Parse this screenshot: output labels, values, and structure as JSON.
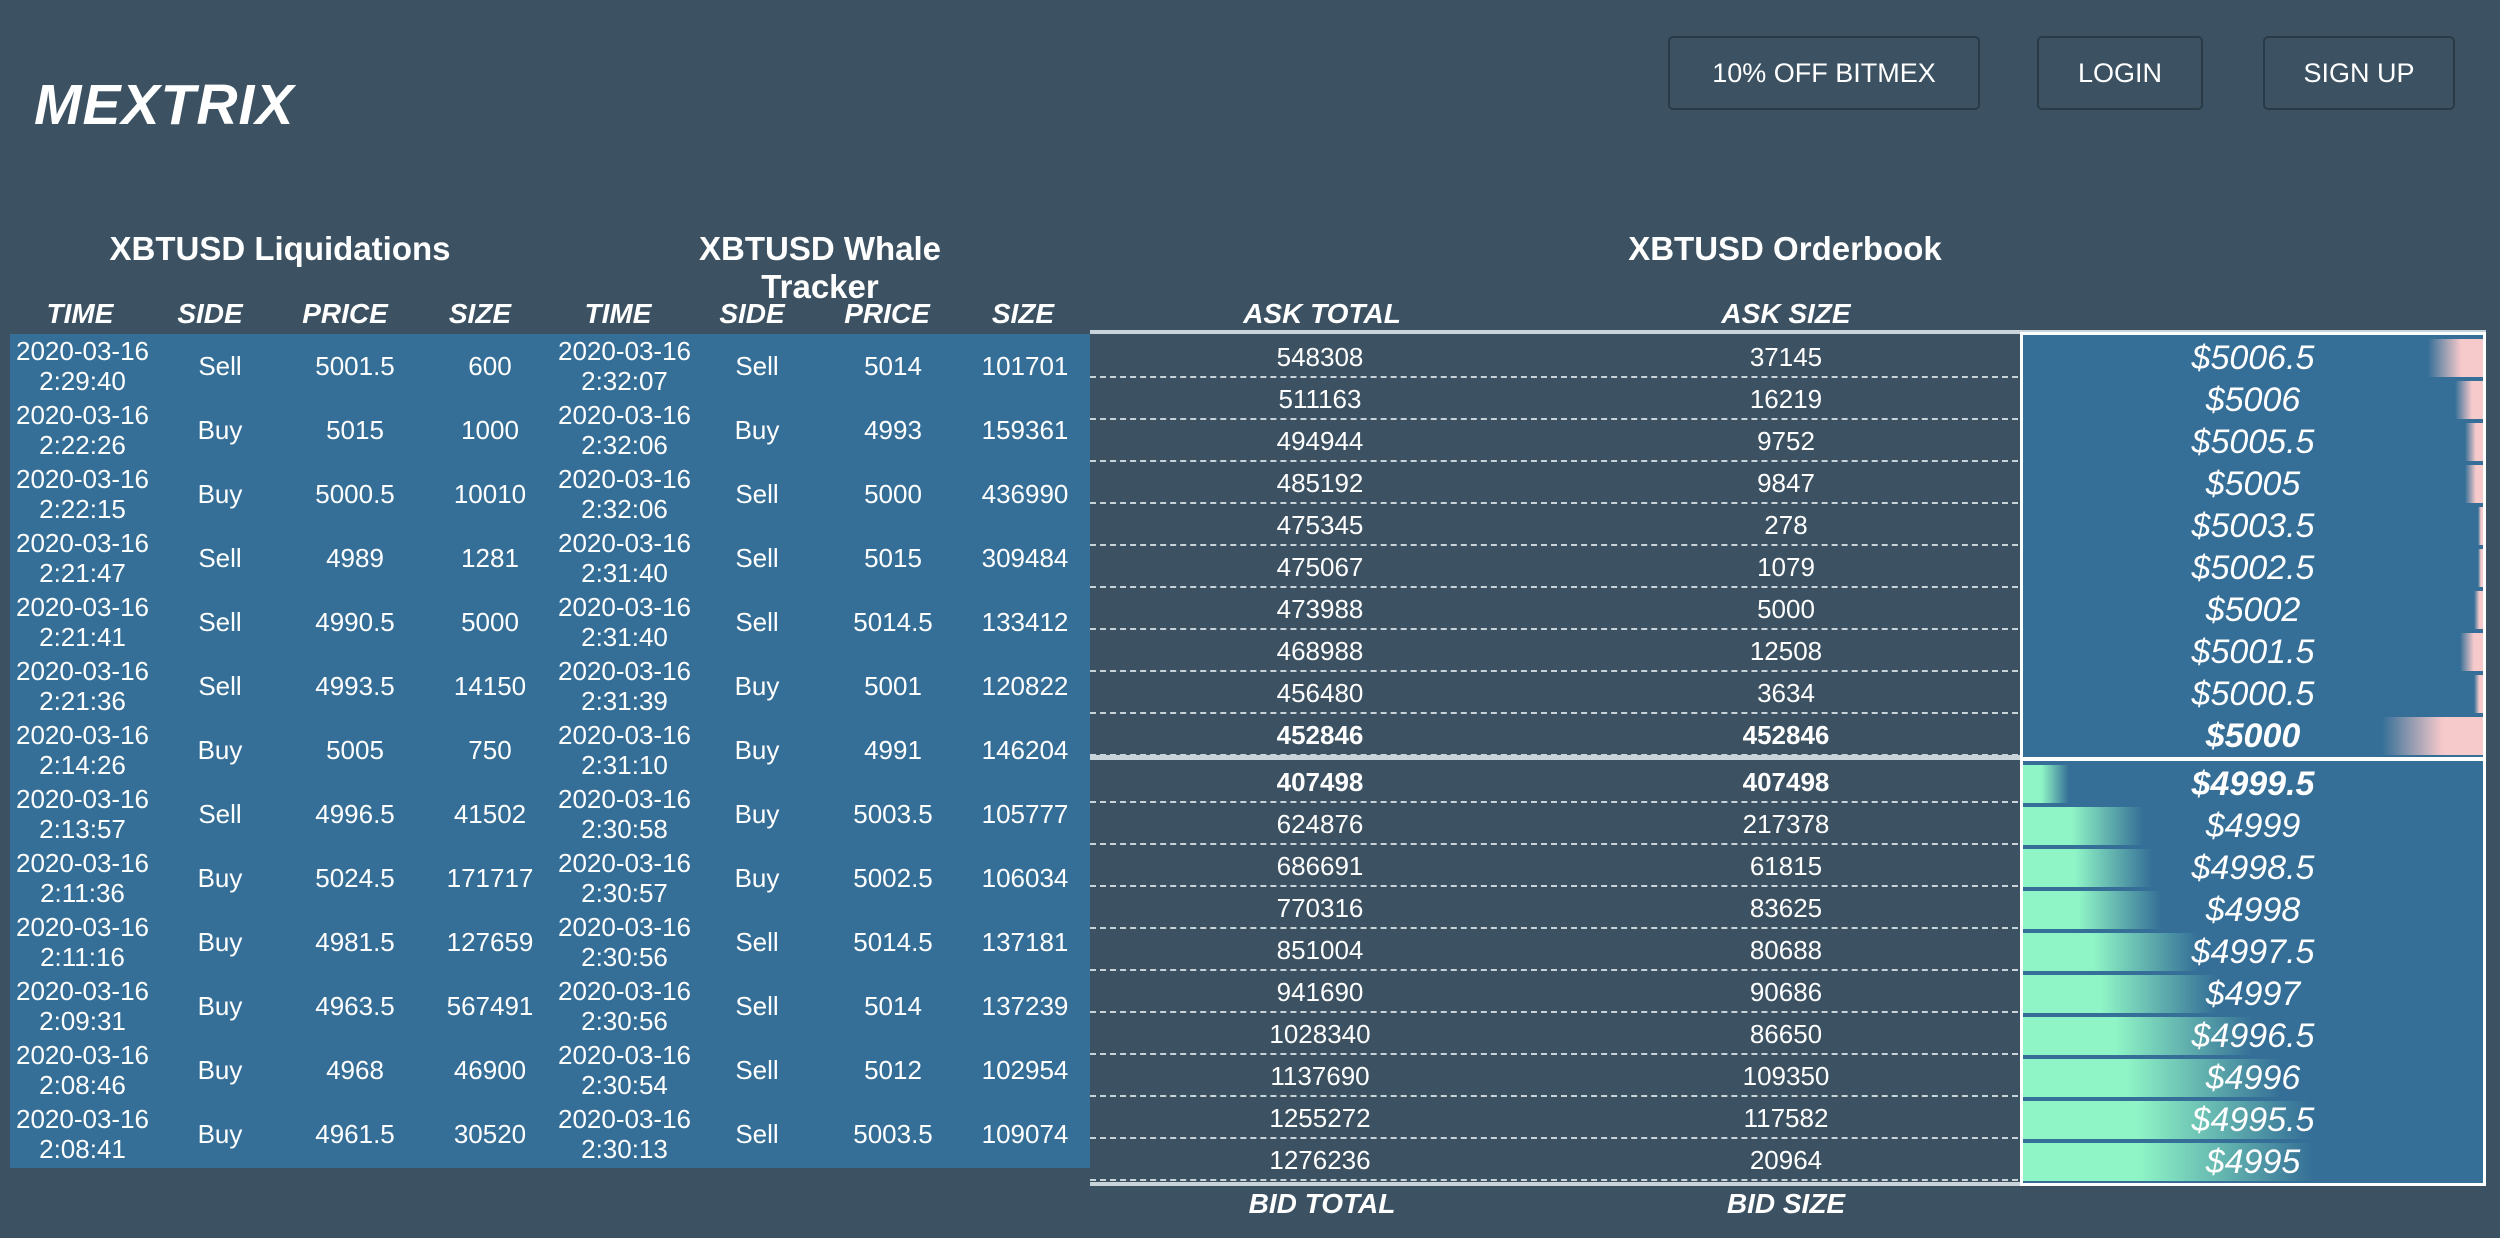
{
  "brand": "MEXTRIX",
  "nav": {
    "promo": "10% OFF BITMEX",
    "login": "LOGIN",
    "signup": "SIGN UP"
  },
  "liquidations": {
    "title": "XBTUSD Liquidations",
    "headers": [
      "TIME",
      "SIDE",
      "PRICE",
      "SIZE"
    ],
    "rows": [
      {
        "date": "2020-03-16",
        "time": "2:29:40",
        "side": "Sell",
        "price": "5001.5",
        "size": "600"
      },
      {
        "date": "2020-03-16",
        "time": "2:22:26",
        "side": "Buy",
        "price": "5015",
        "size": "1000"
      },
      {
        "date": "2020-03-16",
        "time": "2:22:15",
        "side": "Buy",
        "price": "5000.5",
        "size": "10010"
      },
      {
        "date": "2020-03-16",
        "time": "2:21:47",
        "side": "Sell",
        "price": "4989",
        "size": "1281"
      },
      {
        "date": "2020-03-16",
        "time": "2:21:41",
        "side": "Sell",
        "price": "4990.5",
        "size": "5000"
      },
      {
        "date": "2020-03-16",
        "time": "2:21:36",
        "side": "Sell",
        "price": "4993.5",
        "size": "14150"
      },
      {
        "date": "2020-03-16",
        "time": "2:14:26",
        "side": "Buy",
        "price": "5005",
        "size": "750"
      },
      {
        "date": "2020-03-16",
        "time": "2:13:57",
        "side": "Sell",
        "price": "4996.5",
        "size": "41502"
      },
      {
        "date": "2020-03-16",
        "time": "2:11:36",
        "side": "Buy",
        "price": "5024.5",
        "size": "171717"
      },
      {
        "date": "2020-03-16",
        "time": "2:11:16",
        "side": "Buy",
        "price": "4981.5",
        "size": "127659"
      },
      {
        "date": "2020-03-16",
        "time": "2:09:31",
        "side": "Buy",
        "price": "4963.5",
        "size": "567491"
      },
      {
        "date": "2020-03-16",
        "time": "2:08:46",
        "side": "Buy",
        "price": "4968",
        "size": "46900"
      },
      {
        "date": "2020-03-16",
        "time": "2:08:41",
        "side": "Buy",
        "price": "4961.5",
        "size": "30520"
      }
    ]
  },
  "whales": {
    "title": "XBTUSD Whale Tracker",
    "headers": [
      "TIME",
      "SIDE",
      "PRICE",
      "SIZE"
    ],
    "rows": [
      {
        "date": "2020-03-16",
        "time": "2:32:07",
        "side": "Sell",
        "price": "5014",
        "size": "101701"
      },
      {
        "date": "2020-03-16",
        "time": "2:32:06",
        "side": "Buy",
        "price": "4993",
        "size": "159361"
      },
      {
        "date": "2020-03-16",
        "time": "2:32:06",
        "side": "Sell",
        "price": "5000",
        "size": "436990"
      },
      {
        "date": "2020-03-16",
        "time": "2:31:40",
        "side": "Sell",
        "price": "5015",
        "size": "309484"
      },
      {
        "date": "2020-03-16",
        "time": "2:31:40",
        "side": "Sell",
        "price": "5014.5",
        "size": "133412"
      },
      {
        "date": "2020-03-16",
        "time": "2:31:39",
        "side": "Buy",
        "price": "5001",
        "size": "120822"
      },
      {
        "date": "2020-03-16",
        "time": "2:31:10",
        "side": "Buy",
        "price": "4991",
        "size": "146204"
      },
      {
        "date": "2020-03-16",
        "time": "2:30:58",
        "side": "Buy",
        "price": "5003.5",
        "size": "105777"
      },
      {
        "date": "2020-03-16",
        "time": "2:30:57",
        "side": "Buy",
        "price": "5002.5",
        "size": "106034"
      },
      {
        "date": "2020-03-16",
        "time": "2:30:56",
        "side": "Sell",
        "price": "5014.5",
        "size": "137181"
      },
      {
        "date": "2020-03-16",
        "time": "2:30:56",
        "side": "Sell",
        "price": "5014",
        "size": "137239"
      },
      {
        "date": "2020-03-16",
        "time": "2:30:54",
        "side": "Sell",
        "price": "5012",
        "size": "102954"
      },
      {
        "date": "2020-03-16",
        "time": "2:30:13",
        "side": "Sell",
        "price": "5003.5",
        "size": "109074"
      }
    ]
  },
  "orderbook": {
    "title": "XBTUSD Orderbook",
    "ask_total_label": "ASK TOTAL",
    "ask_size_label": "ASK SIZE",
    "bid_total_label": "BID TOTAL",
    "bid_size_label": "BID SIZE",
    "asks": [
      {
        "total": "548308",
        "size": "37145",
        "price": "$5006.5",
        "depth": 0.12
      },
      {
        "total": "511163",
        "size": "16219",
        "price": "$5006",
        "depth": 0.06
      },
      {
        "total": "494944",
        "size": "9752",
        "price": "$5005.5",
        "depth": 0.04
      },
      {
        "total": "485192",
        "size": "9847",
        "price": "$5005",
        "depth": 0.04
      },
      {
        "total": "475345",
        "size": "278",
        "price": "$5003.5",
        "depth": 0.01
      },
      {
        "total": "475067",
        "size": "1079",
        "price": "$5002.5",
        "depth": 0.01
      },
      {
        "total": "473988",
        "size": "5000",
        "price": "$5002",
        "depth": 0.02
      },
      {
        "total": "468988",
        "size": "12508",
        "price": "$5001.5",
        "depth": 0.05
      },
      {
        "total": "456480",
        "size": "3634",
        "price": "$5000.5",
        "depth": 0.02
      },
      {
        "total": "452846",
        "size": "452846",
        "price": "$5000",
        "depth": 0.22,
        "bold": true
      }
    ],
    "bids": [
      {
        "total": "407498",
        "size": "407498",
        "price": "$4999.5",
        "depth": 0.1,
        "bold": true
      },
      {
        "total": "624876",
        "size": "217378",
        "price": "$4999",
        "depth": 0.26
      },
      {
        "total": "686691",
        "size": "61815",
        "price": "$4998.5",
        "depth": 0.28
      },
      {
        "total": "770316",
        "size": "83625",
        "price": "$4998",
        "depth": 0.3
      },
      {
        "total": "851004",
        "size": "80688",
        "price": "$4997.5",
        "depth": 0.38
      },
      {
        "total": "941690",
        "size": "90686",
        "price": "$4997",
        "depth": 0.42
      },
      {
        "total": "1028340",
        "size": "86650",
        "price": "$4996.5",
        "depth": 0.5
      },
      {
        "total": "1137690",
        "size": "109350",
        "price": "$4996",
        "depth": 0.56
      },
      {
        "total": "1255272",
        "size": "117582",
        "price": "$4995.5",
        "depth": 0.62
      },
      {
        "total": "1276236",
        "size": "20964",
        "price": "$4995",
        "depth": 0.63
      }
    ]
  },
  "colors": {
    "background": "#3c5262",
    "panel": "#356f97",
    "ask_bar": "#f6c9cb",
    "bid_bar": "#8ff5c6"
  }
}
